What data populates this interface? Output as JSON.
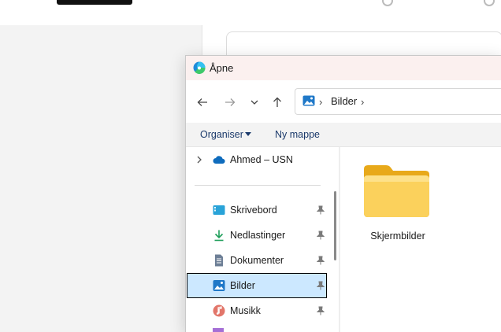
{
  "dialog": {
    "title": "Åpne"
  },
  "address": {
    "location": "Bilder"
  },
  "command_bar": {
    "organize": "Organiser",
    "new_folder": "Ny mappe"
  },
  "sidebar": {
    "cloud_item": "Ahmed – USN",
    "items": [
      {
        "label": "Skrivebord",
        "icon": "desktop-icon"
      },
      {
        "label": "Nedlastinger",
        "icon": "download-icon"
      },
      {
        "label": "Dokumenter",
        "icon": "document-icon"
      },
      {
        "label": "Bilder",
        "icon": "pictures-icon",
        "selected": true
      },
      {
        "label": "Musikk",
        "icon": "music-icon"
      }
    ]
  },
  "content": {
    "folders": [
      {
        "name": "Skjermbilder"
      }
    ]
  },
  "colors": {
    "selection": "#cce8ff",
    "titlebar": "#fbf0ef",
    "folder": "#f9c93f",
    "cloud": "#0f6cbd"
  }
}
